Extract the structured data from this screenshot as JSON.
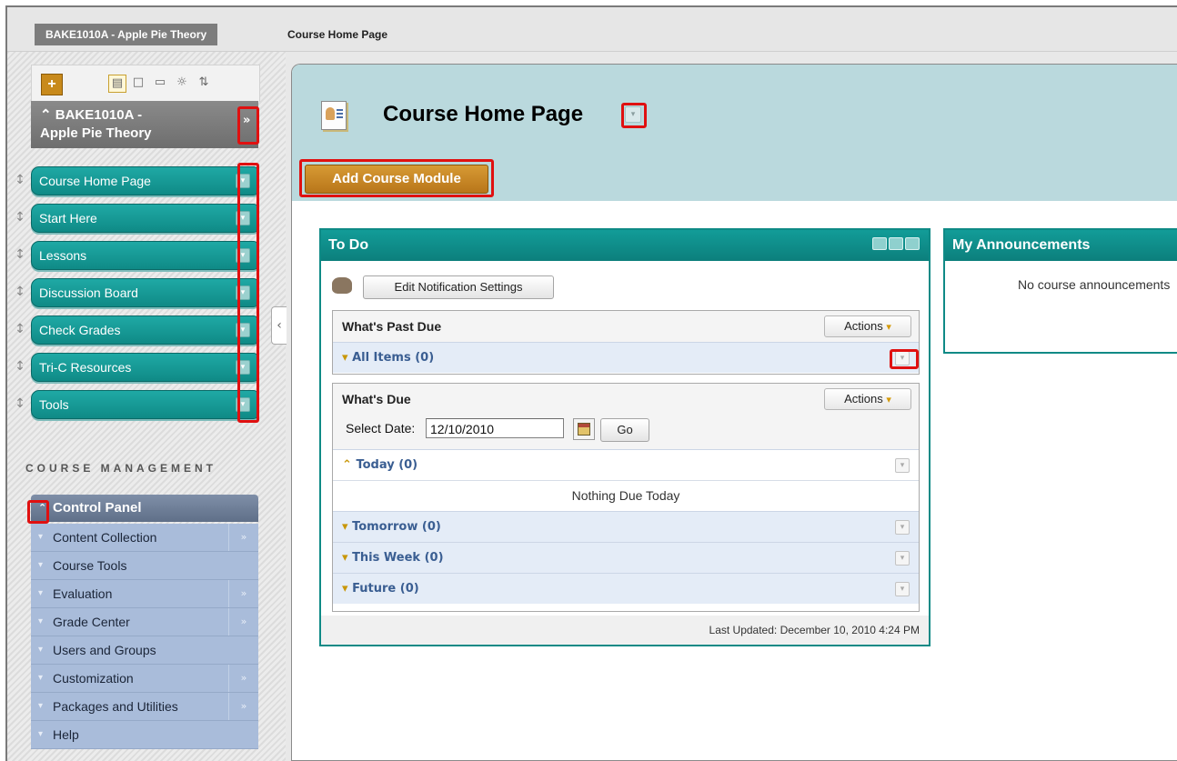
{
  "breadcrumb": {
    "course": "BAKE1010A - Apple Pie Theory",
    "page": "Course Home Page"
  },
  "course_menu": {
    "title_line1": "BAKE1010A -",
    "title_line2": "Apple Pie Theory",
    "title_chevron": "»",
    "items": [
      {
        "label": "Course Home Page"
      },
      {
        "label": "Start Here"
      },
      {
        "label": "Lessons"
      },
      {
        "label": "Discussion Board"
      },
      {
        "label": "Check Grades"
      },
      {
        "label": "Tri-C Resources"
      },
      {
        "label": "Tools"
      }
    ]
  },
  "course_management": {
    "title": "COURSE MANAGEMENT",
    "control_panel": "Control Panel",
    "items": [
      {
        "label": "Content Collection",
        "has_submenu": true
      },
      {
        "label": "Course Tools",
        "has_submenu": false
      },
      {
        "label": "Evaluation",
        "has_submenu": true
      },
      {
        "label": "Grade Center",
        "has_submenu": true
      },
      {
        "label": "Users and Groups",
        "has_submenu": false
      },
      {
        "label": "Customization",
        "has_submenu": true
      },
      {
        "label": "Packages and Utilities",
        "has_submenu": true
      },
      {
        "label": "Help",
        "has_submenu": false
      }
    ]
  },
  "content": {
    "page_title": "Course Home Page",
    "add_module": "Add Course Module"
  },
  "todo": {
    "title": "To Do",
    "edit_notification": "Edit Notification Settings",
    "past_due": {
      "title": "What's Past Due",
      "actions": "Actions",
      "all_items": "All Items (0)"
    },
    "due": {
      "title": "What's Due",
      "actions": "Actions",
      "select_date_label": "Select Date:",
      "date_value": "12/10/2010",
      "go": "Go",
      "today": "Today (0)",
      "nothing_due_today": "Nothing Due Today",
      "tomorrow": "Tomorrow (0)",
      "this_week": "This Week (0)",
      "future": "Future (0)"
    },
    "last_updated": "Last Updated: December 10, 2010 4:24 PM"
  },
  "announcements": {
    "title": "My Announcements",
    "empty": "No course announcements"
  },
  "colors": {
    "teal": "#0f8a86",
    "highlight_red": "#e01010",
    "header_bg": "#bad9dd",
    "add_button": "#c88a1c"
  }
}
